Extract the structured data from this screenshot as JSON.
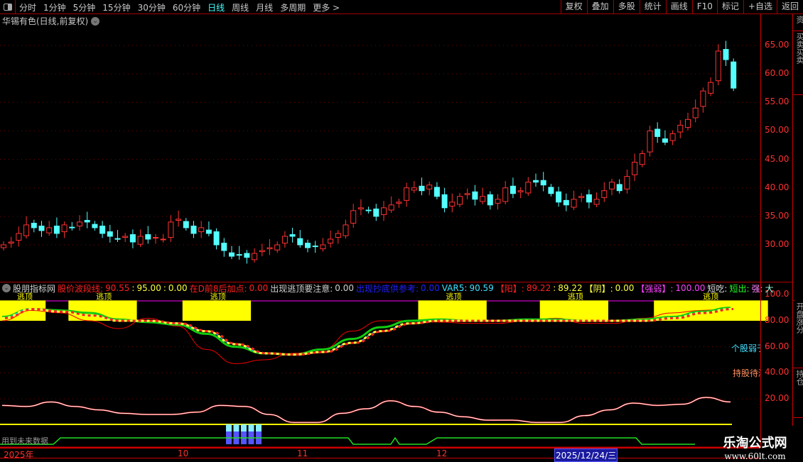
{
  "toolbar": {
    "periods": [
      "分时",
      "1分钟",
      "5分钟",
      "15分钟",
      "30分钟",
      "60分钟",
      "日线",
      "周线",
      "月线",
      "多周期",
      "更多 >"
    ],
    "active_period": "日线",
    "buttons": [
      "复权",
      "叠加",
      "多股",
      "统计",
      "画线",
      "F10",
      "标记",
      "+自选",
      "返回"
    ]
  },
  "chart_title": "华锡有色(日线,前复权)",
  "price_axis": [
    "65.00",
    "60.00",
    "55.00",
    "50.00",
    "45.00",
    "40.00",
    "35.00",
    "30.00"
  ],
  "right_panel": [
    "资",
    "买卖买卖",
    "",
    "开盘涨分",
    "持仓"
  ],
  "indicator": {
    "name": "股朋指标网",
    "items": [
      {
        "label": "股价波段线:",
        "value": "90.55",
        "color": "#ff2020"
      },
      {
        "label": ":",
        "value": "95.00",
        "color": "#ffff40"
      },
      {
        "label": ":",
        "value": "0.00",
        "color": "#ffff40"
      },
      {
        "label": "在D前8后加点:",
        "value": "0.00",
        "color": "#ff2020"
      },
      {
        "label": "出现逃顶要注意:",
        "value": "0.00",
        "color": "#d0d0d0"
      },
      {
        "label": "出现抄底供参考:",
        "value": "0.00",
        "color": "#2020ff"
      },
      {
        "label": "VAR5:",
        "value": "90.59",
        "color": "#40e0ff"
      },
      {
        "label": "【阳】:",
        "value": "89.22",
        "color": "#ff2020"
      },
      {
        "label": ":",
        "value": "89.22",
        "color": "#ffff40"
      },
      {
        "label": "【阴】:",
        "value": "0.00",
        "color": "#ffff40"
      },
      {
        "label": "【强弱】:",
        "value": "100.00",
        "color": "#ff40ff"
      },
      {
        "label": "短吃:",
        "value": "",
        "color": "#e0e0e0"
      },
      {
        "label": "短出:",
        "value": "",
        "color": "#20ff20"
      },
      {
        "label": "强:",
        "value": "",
        "color": "#ff80ff"
      },
      {
        "label": "大",
        "value": "",
        "color": "#a0ffe0"
      }
    ],
    "axis": [
      "100.0",
      "80.00",
      "60.00",
      "40.00",
      "20.00"
    ],
    "band_label": "逃顶",
    "notes": [
      {
        "text": "个股弱于",
        "color": "#40e0ff"
      },
      {
        "text": "持股待涨",
        "color": "#ff9060"
      }
    ],
    "future_note": "用到未来数据"
  },
  "dates": {
    "year": "2025年",
    "m10": "10",
    "m11": "11",
    "m12": "12",
    "cursor": "2025/12/24/三"
  },
  "watermark": {
    "name": "乐淘公式网",
    "url": "www.60lt.com"
  },
  "chart_data": {
    "type": "candlestick",
    "closes": [
      30,
      30.5,
      32,
      33.5,
      33,
      32.5,
      33,
      32,
      33.5,
      33,
      34,
      34,
      33,
      32,
      31.5,
      31,
      31.5,
      30.5,
      31.5,
      31,
      31.3,
      31,
      34,
      34.5,
      33,
      32,
      33,
      32,
      30,
      29,
      28,
      28.2,
      27.8,
      28.5,
      29,
      29.5,
      30,
      31.5,
      31.5,
      30,
      29.5,
      29.7,
      30,
      31,
      32,
      33.5,
      36,
      36.5,
      36,
      35,
      36.5,
      37,
      37.5,
      40,
      40,
      39.5,
      40.5,
      38.5,
      36.5,
      37.5,
      38.5,
      39,
      38,
      38.5,
      37,
      38,
      40,
      39,
      39.5,
      41,
      41,
      40.5,
      39,
      37.5,
      37,
      38,
      38.5,
      37.5,
      38,
      39.5,
      41,
      39.5,
      42,
      44.5,
      46,
      50,
      49,
      48,
      49.5,
      51,
      52,
      54,
      57,
      58.5,
      64,
      62.5,
      57.5
    ],
    "ylim": [
      25,
      68
    ],
    "wave": [
      82,
      89,
      87,
      84,
      80,
      80,
      78,
      72,
      62,
      55,
      54,
      56,
      63,
      72,
      78,
      80,
      80,
      80,
      80,
      80,
      80,
      80,
      80,
      82,
      86,
      89
    ],
    "wave2": [
      83,
      89,
      88,
      86,
      81,
      79,
      77,
      70,
      60,
      55,
      54,
      58,
      66,
      75,
      80,
      81,
      80,
      80,
      81,
      81,
      80,
      80,
      81,
      83,
      87,
      90
    ],
    "red": [
      80,
      88,
      86,
      80,
      74,
      82,
      76,
      58,
      47,
      50,
      55,
      58,
      72,
      80,
      80,
      79,
      78,
      78,
      80,
      82,
      78,
      78,
      82,
      86,
      88,
      89
    ],
    "bands": [
      [
        0,
        6
      ],
      [
        9,
        18
      ],
      [
        24,
        33
      ],
      [
        55,
        64
      ],
      [
        71,
        80
      ],
      [
        86,
        101
      ]
    ],
    "osc": [
      18,
      17,
      21,
      17,
      14,
      11,
      10,
      10,
      12,
      18,
      17,
      10,
      3,
      3,
      11,
      15,
      22,
      17,
      12,
      8,
      5,
      5,
      3,
      3,
      9,
      14,
      20,
      18,
      19,
      25,
      21
    ],
    "flag_bars": [
      30,
      31,
      32,
      33,
      34
    ]
  }
}
